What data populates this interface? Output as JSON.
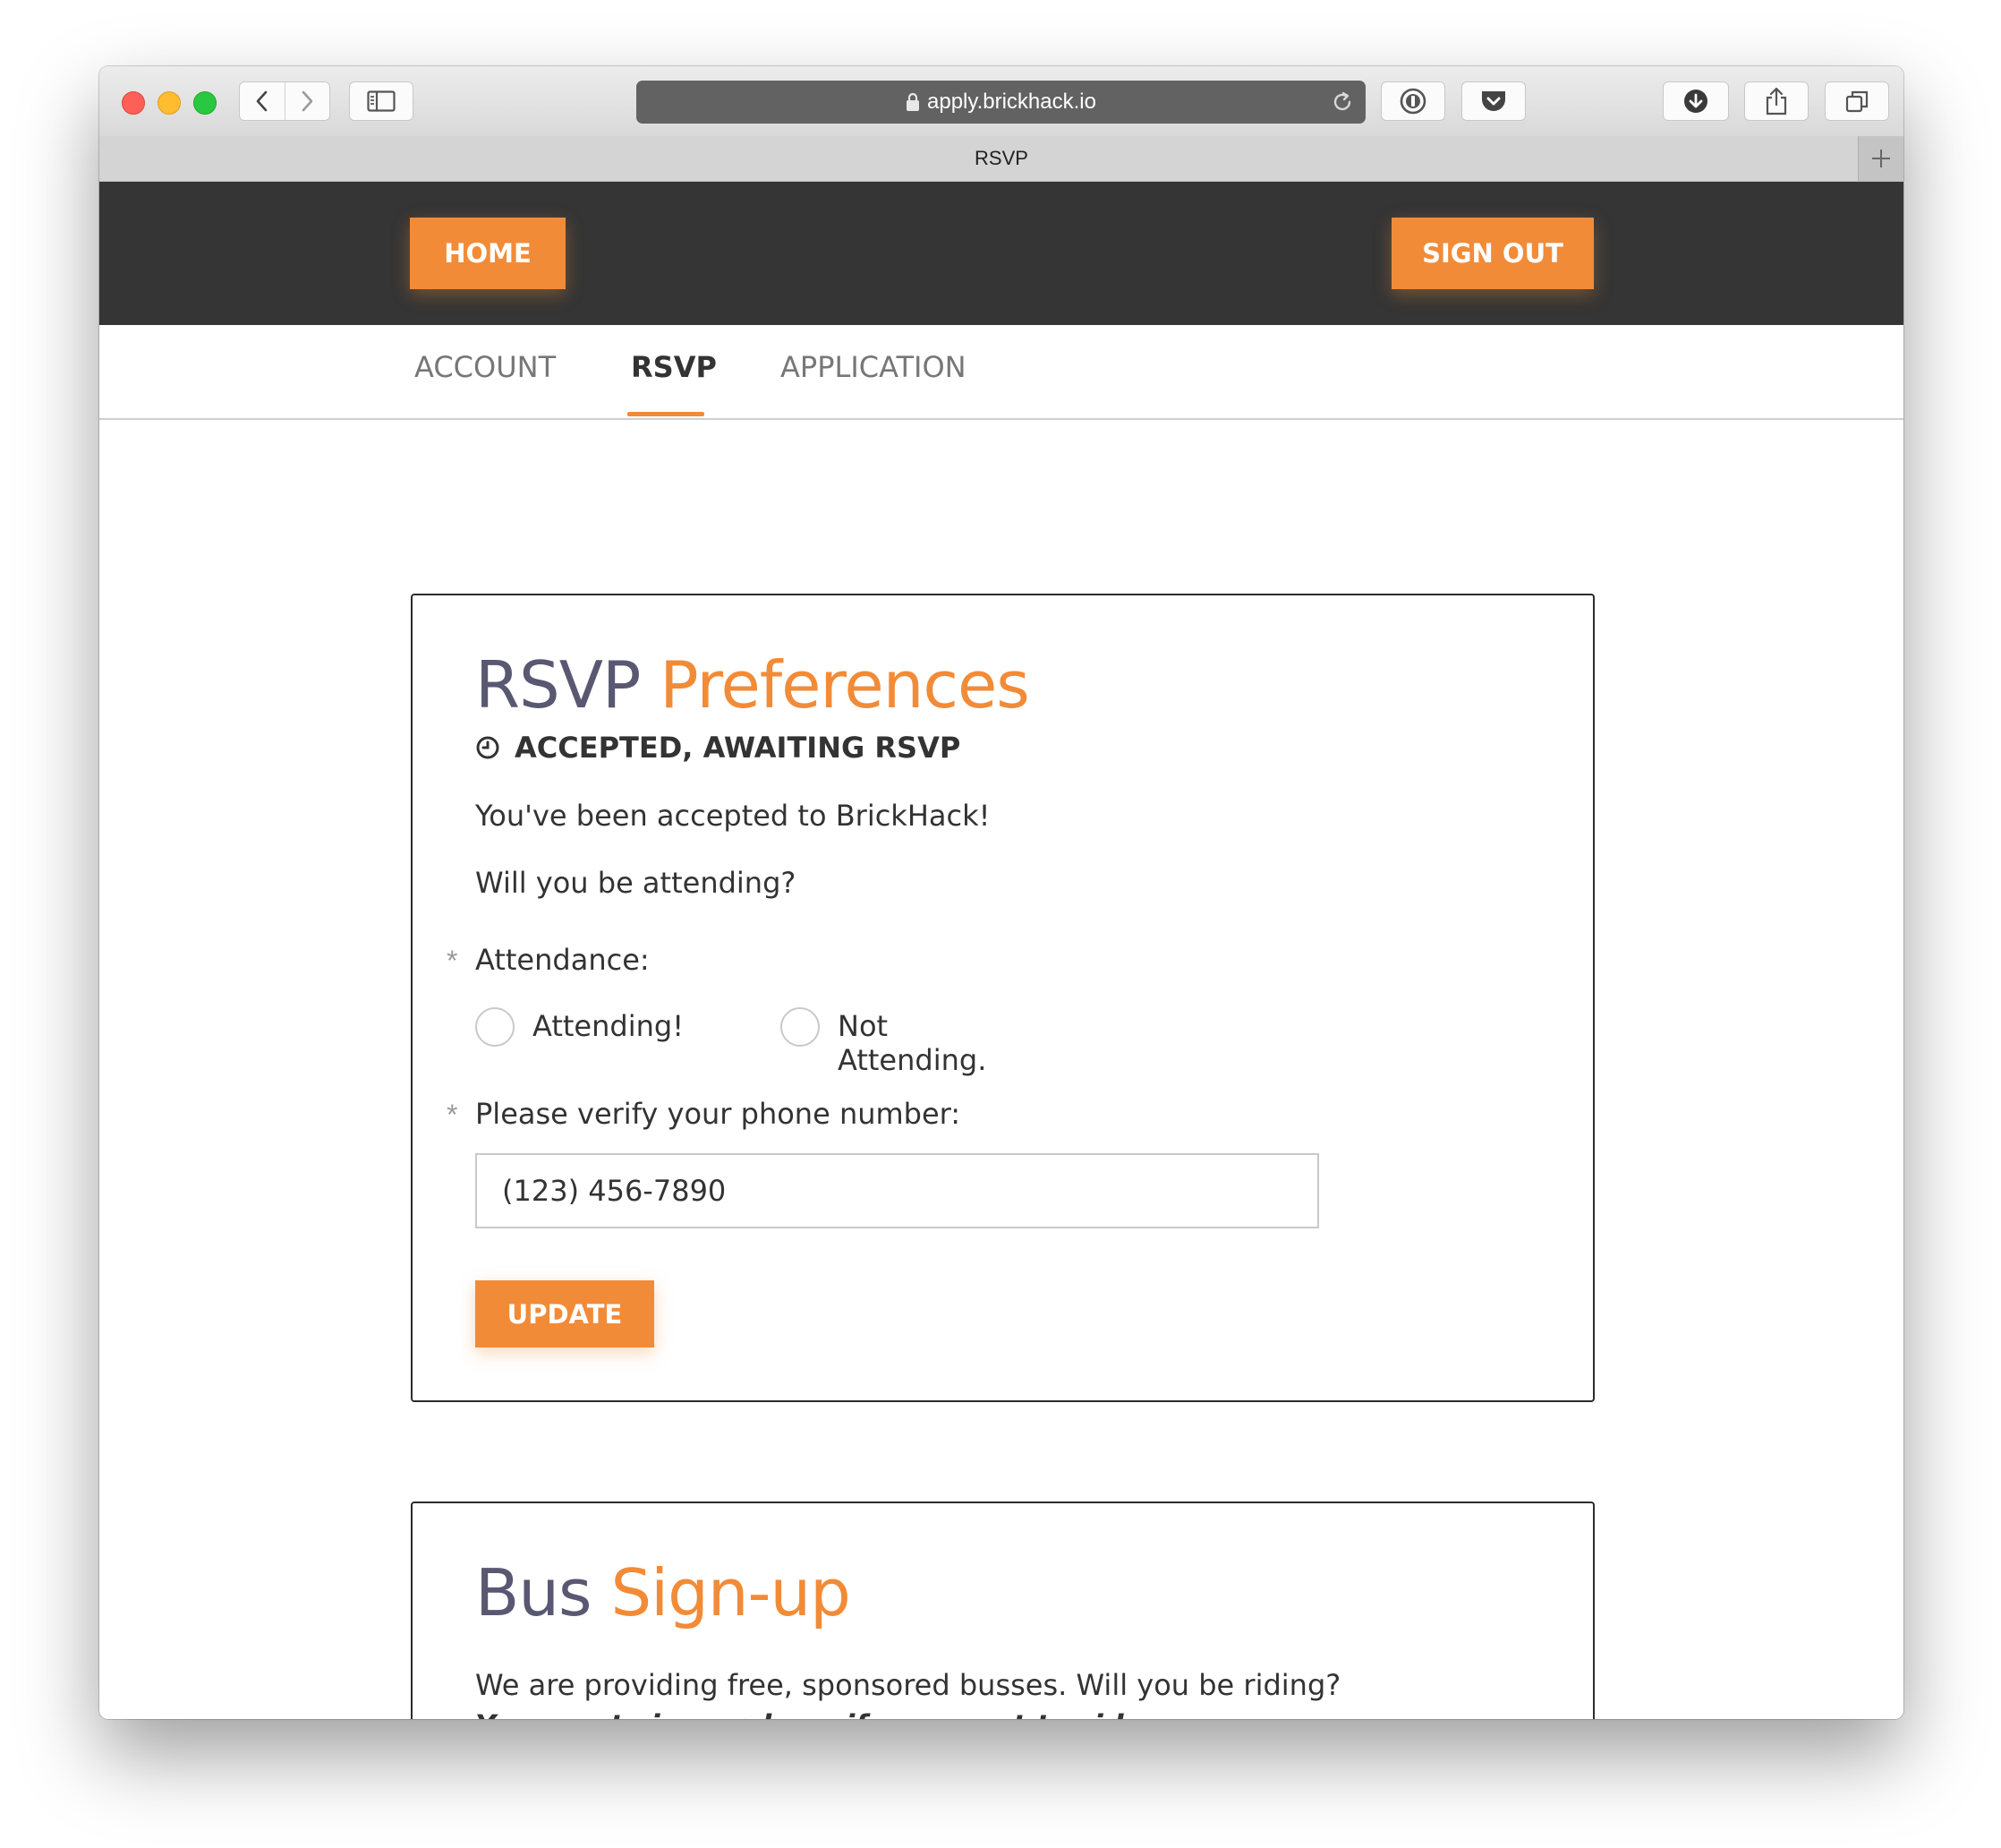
{
  "browser": {
    "url": "apply.brickhack.io",
    "tab_title": "RSVP"
  },
  "header": {
    "home_label": "HOME",
    "signout_label": "SIGN OUT"
  },
  "subnav": {
    "items": [
      {
        "label": "ACCOUNT",
        "active": false
      },
      {
        "label": "RSVP",
        "active": true
      },
      {
        "label": "APPLICATION",
        "active": false
      }
    ]
  },
  "rsvp_card": {
    "title_main": "RSVP",
    "title_accent": "Preferences",
    "status": "ACCEPTED, AWAITING RSVP",
    "accepted_text": "You've been accepted to BrickHack!",
    "question": "Will you be attending?",
    "attendance_label": "Attendance:",
    "options": [
      "Attending!",
      "Not Attending."
    ],
    "phone_label": "Please verify your phone number:",
    "phone_value": "(123) 456-7890",
    "update_label": "UPDATE",
    "required_marker": "*"
  },
  "bus_card": {
    "title_main": "Bus",
    "title_accent": "Sign-up",
    "line1": "We are providing free, sponsored busses. Will you be riding?",
    "line2": "You must sign up here if you want to ride."
  },
  "colors": {
    "accent": "#f28b37",
    "header_bg": "#353535",
    "title_gray": "#585872"
  }
}
